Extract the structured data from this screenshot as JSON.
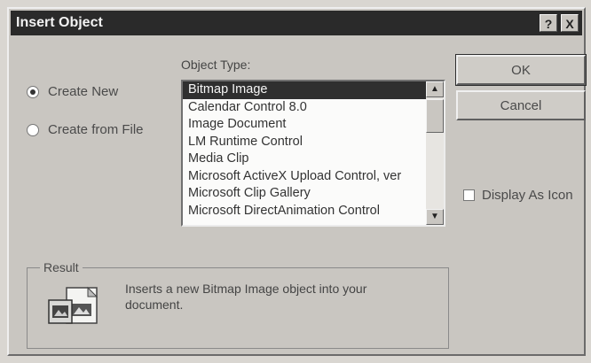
{
  "dialog": {
    "title": "Insert Object",
    "help_button": "?",
    "close_button": "X"
  },
  "options": {
    "create_new": "Create New",
    "create_new_checked": true,
    "create_from_file": "Create from File"
  },
  "object_type": {
    "label": "Object Type:",
    "items": [
      "Bitmap Image",
      "Calendar Control 8.0",
      "Image Document",
      "LM Runtime Control",
      "Media Clip",
      "Microsoft ActiveX Upload Control, ver",
      "Microsoft Clip Gallery",
      "Microsoft DirectAnimation Control"
    ],
    "selected_index": 0
  },
  "buttons": {
    "ok": "OK",
    "cancel": "Cancel"
  },
  "display_as_icon": {
    "label": "Display As Icon",
    "checked": false
  },
  "result": {
    "label": "Result",
    "text": "Inserts a new Bitmap Image object into your document."
  },
  "colors": {
    "titlebar": "#2a2a2a",
    "face": "#c9c6c1",
    "selection": "#2f2f2f"
  }
}
